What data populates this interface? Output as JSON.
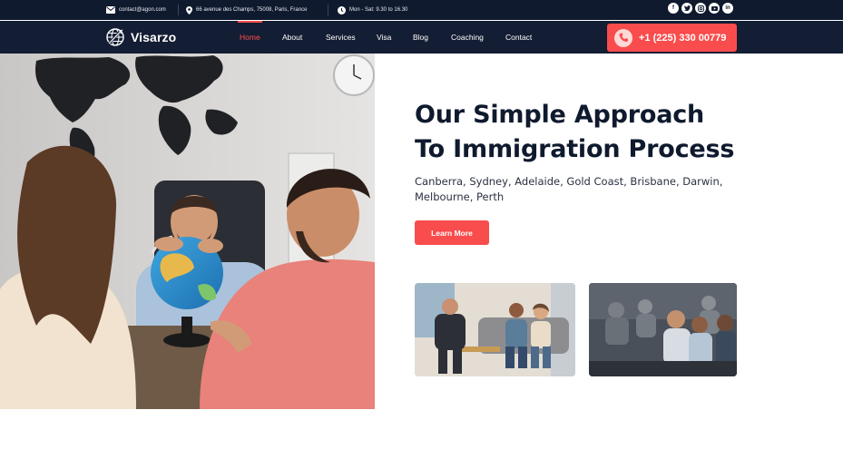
{
  "topbar": {
    "email": "contact@agon.com",
    "address": "66 avenue des Champs, 75008, Paris, France",
    "hours": "Mon - Sat: 9.30 to 16.30",
    "socials": [
      "facebook-icon",
      "twitter-icon",
      "instagram-icon",
      "youtube-icon",
      "linkedin-icon"
    ]
  },
  "nav": {
    "logo": "Visarzo",
    "items": [
      "Home",
      "About",
      "Services",
      "Visa",
      "Blog",
      "Coaching",
      "Contact"
    ],
    "active": "Home",
    "phone": "+1 (225) 330 00779"
  },
  "hero": {
    "title_line1": "Our Simple Approach",
    "title_line2": "To Immigration Process",
    "subtitle": "Canberra, Sydney, Adelaide, Gold Coast, Brisbane, Darwin, Melbourne, Perth",
    "button": "Learn More"
  },
  "colors": {
    "dark_navy": "#0f1a2e",
    "accent_red": "#f94c4c"
  }
}
